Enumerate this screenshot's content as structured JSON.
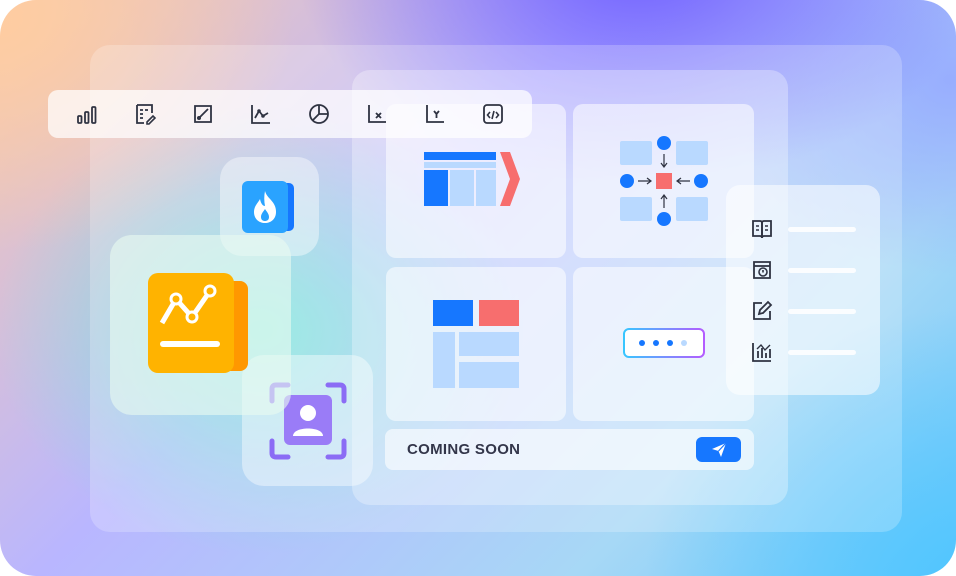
{
  "colors": {
    "primary_blue": "#1677ff",
    "light_blue": "#b9d9ff",
    "coral": "#f76e6e",
    "orange": "#ffa61a",
    "purple": "#8b6cf5",
    "icon_dark": "#2f3342"
  },
  "toolbar": {
    "icons": [
      "bar-chart-icon",
      "list-edit-icon",
      "edit-square-icon",
      "line-chart-icon",
      "pie-chart-icon",
      "x-axis-icon",
      "y-axis-icon",
      "code-icon"
    ]
  },
  "apps": {
    "fire_icon": "fire-icon",
    "chart_icon": "trend-chart-icon",
    "user_scan_icon": "user-scan-icon"
  },
  "side_panel": {
    "icons": [
      "book-icon",
      "warning-icon",
      "edit-icon",
      "stats-icon"
    ]
  },
  "coming_soon": {
    "label": "COMING SOON",
    "icon": "send-icon"
  }
}
